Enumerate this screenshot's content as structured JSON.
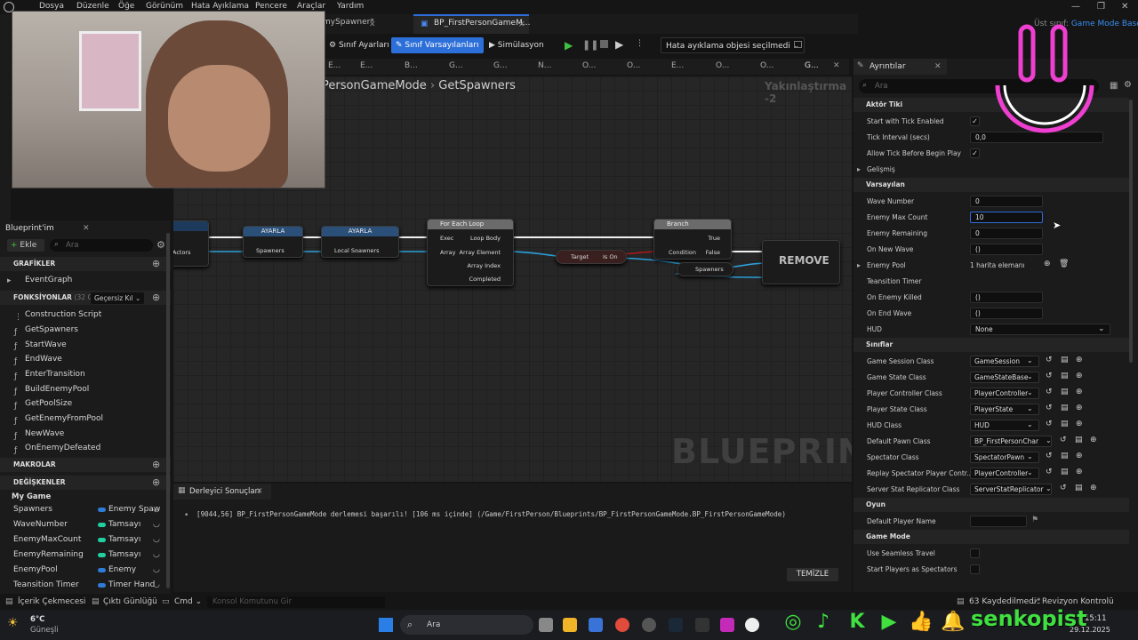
{
  "menu": [
    "Dosya",
    "Düzenle",
    "Öğe",
    "Görünüm",
    "Hata Ayıklama",
    "Pencere",
    "Araçlar",
    "Yardım"
  ],
  "window_controls": {
    "min": "—",
    "max": "❐",
    "close": "✕"
  },
  "tabs": {
    "spawner": "myEnemySpawner",
    "spawner_visible": "mySpawner*",
    "gamemode": "BP_FirstPersonGameM..."
  },
  "parent_class": {
    "label": "Üst sınıf:",
    "value": "Game Mode Base"
  },
  "toolbar": {
    "class_settings": "Sınıf Ayarları",
    "class_defaults": "Sınıf Varsayılanları",
    "simulation": "Simülasyon",
    "debug_object": "Hata ayıklama objesi seçilmedi"
  },
  "fn_tabs": [
    "E...",
    "E...",
    "B...",
    "G...",
    "G...",
    "N...",
    "O...",
    "O...",
    "E...",
    "O...",
    "O...",
    "G..."
  ],
  "breadcrumb": {
    "left": "PersonGameMode",
    "sep": "›",
    "right": "GetSpawners",
    "zoom": "Yakınlaştırma -2"
  },
  "graph": {
    "watermark": "BLUEPRINT",
    "node_actors": "st Actors",
    "set1": {
      "title": "AYARLA",
      "pin": "Spawners"
    },
    "set2": {
      "title": "AYARLA",
      "pin": "Local Soawners"
    },
    "foreach": {
      "title": "For Each Loop",
      "exec": "Exec",
      "array": "Array",
      "loop_body": "Loop Body",
      "array_element": "Array Element",
      "array_index": "Array Index",
      "completed": "Completed"
    },
    "ison": {
      "target": "Target",
      "ison": "Is On"
    },
    "branch": {
      "title": "Branch",
      "true": "True",
      "condition": "Condition",
      "false": "False"
    },
    "spawners_get": "Spawners",
    "remove": "REMOVE"
  },
  "left_panel": {
    "title": "Blueprint'im",
    "add": "Ekle",
    "search_placeholder": "Ara",
    "graphs_header": "GRAFİKLER",
    "event_graph": "EventGraph",
    "functions_header": "FONKSİYONLAR",
    "functions_count": "(32 GEÇER",
    "override": "Geçersiz Kıl",
    "functions": [
      "Construction Script",
      "GetSpawners",
      "StartWave",
      "EndWave",
      "EnterTransition",
      "BuildEnemyPool",
      "GetPoolSize",
      "GetEnemyFromPool",
      "NewWave",
      "OnEnemyDefeated"
    ],
    "macros_header": "MAKROLAR",
    "variables_header": "DEĞİŞKENLER",
    "category": "My Game",
    "variables": [
      {
        "name": "Spawners",
        "type": "Enemy Spaw",
        "color": "#2f7bd6"
      },
      {
        "name": "WaveNumber",
        "type": "Tamsayı",
        "color": "#1fd1a0"
      },
      {
        "name": "EnemyMaxCount",
        "type": "Tamsayı",
        "color": "#1fd1a0"
      },
      {
        "name": "EnemyRemaining",
        "type": "Tamsayı",
        "color": "#1fd1a0"
      },
      {
        "name": "EnemyPool",
        "type": "Enemy",
        "color": "#2f7bd6"
      },
      {
        "name": "Teansition Timer",
        "type": "Timer Hand",
        "color": "#2f7bd6"
      }
    ]
  },
  "compiler": {
    "tab": "Derleyici Sonuçları",
    "message": "[9044,56] BP_FirstPersonGameMode derlemesi başarılı! [106 ms içinde] (/Game/FirstPerson/Blueprints/BP_FirstPersonGameMode.BP_FirstPersonGameMode)",
    "clear": "TEMİZLE"
  },
  "details": {
    "tab": "Ayrıntılar",
    "search_placeholder": "Ara",
    "actor_tick": "Aktör Tiki",
    "start_tick": "Start with Tick Enabled",
    "tick_interval": "Tick Interval (secs)",
    "tick_interval_val": "0,0",
    "allow_tick": "Allow Tick Before Begin Play",
    "advanced": "Gelişmiş",
    "defaults": "Varsayılan",
    "wave_number": "Wave Number",
    "wave_number_val": "0",
    "enemy_max": "Enemy Max Count",
    "enemy_max_val": "10",
    "enemy_remaining": "Enemy Remaining",
    "enemy_remaining_val": "0",
    "on_new_wave": "On New Wave",
    "on_new_wave_val": "()",
    "enemy_pool": "Enemy Pool",
    "enemy_pool_val": "1 harita elemanı",
    "transition_timer": "Teansition Timer",
    "on_enemy_killed": "On Enemy Killed",
    "on_enemy_killed_val": "()",
    "on_end_wave": "On End Wave",
    "on_end_wave_val": "()",
    "hud": "HUD",
    "hud_val": "None",
    "classes": "Sınıflar",
    "class_rows": [
      {
        "label": "Game Session Class",
        "value": "GameSession"
      },
      {
        "label": "Game State Class",
        "value": "GameStateBase"
      },
      {
        "label": "Player Controller Class",
        "value": "PlayerController"
      },
      {
        "label": "Player State Class",
        "value": "PlayerState"
      },
      {
        "label": "HUD Class",
        "value": "HUD"
      },
      {
        "label": "Default Pawn Class",
        "value": "BP_FirstPersonChar"
      },
      {
        "label": "Spectator Class",
        "value": "SpectatorPawn"
      },
      {
        "label": "Replay Spectator Player Contr...",
        "value": "PlayerController"
      },
      {
        "label": "Server Stat Replicator Class",
        "value": "ServerStatReplicator"
      }
    ],
    "game": "Oyun",
    "default_player_name": "Default Player Name",
    "game_mode": "Game Mode",
    "seamless": "Use Seamless Travel",
    "spectators": "Start Players as Spectators"
  },
  "statusbar": {
    "content_drawer": "İçerik Çekmecesi",
    "output_log": "Çıktı Günlüğü",
    "cmd": "Cmd",
    "console_placeholder": "Konsol Komutunu Gir",
    "saved": "63 Kaydedilmedi",
    "revision": "Revizyon Kontrolü"
  },
  "taskbar": {
    "temp": "6°C",
    "weather": "Güneşli",
    "search": "Ara",
    "time": "15:11",
    "date": "29.12.2025"
  },
  "overlay": {
    "channel": "senkopist"
  }
}
